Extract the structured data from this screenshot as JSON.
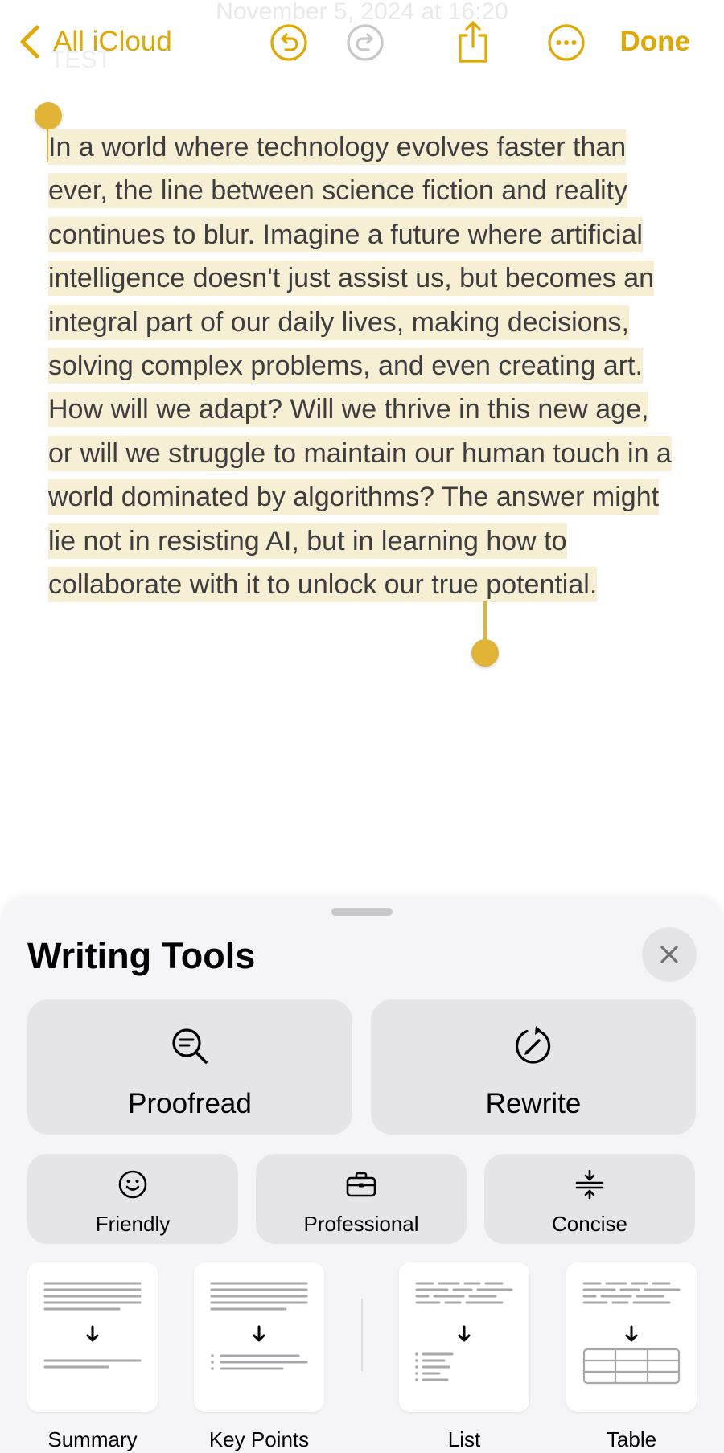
{
  "header": {
    "ghost_date": "November 5, 2024 at 16:20",
    "ghost_title": "TEST",
    "back_label": "All iCloud",
    "done_label": "Done",
    "accent_color": "#E0A800"
  },
  "toolbar_icons": [
    "undo-icon",
    "redo-icon",
    "share-icon",
    "more-icon"
  ],
  "note": {
    "text": "In a world where technology evolves faster than ever, the line between science fiction and reality continues to blur. Imagine a future where artificial intelligence doesn't just assist us, but becomes an integral part of our daily lives, making decisions, solving complex problems, and even creating art. How will we adapt? Will we thrive in this new age, or will we struggle to maintain our human touch in a world dominated by algorithms? The answer might lie not in resisting AI, but in learning how to collaborate with it to unlock our true potential.",
    "selection_color": "#F6EFD3"
  },
  "writing_tools": {
    "title": "Writing Tools",
    "proofread_label": "Proofread",
    "rewrite_label": "Rewrite",
    "friendly_label": "Friendly",
    "professional_label": "Professional",
    "concise_label": "Concise",
    "summary_label": "Summary",
    "key_points_label": "Key Points",
    "list_label": "List",
    "table_label": "Table"
  }
}
